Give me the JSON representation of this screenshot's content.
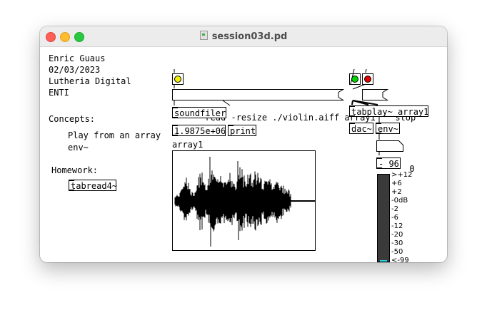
{
  "window": {
    "title": "session03d.pd"
  },
  "header_comments": [
    "Enric Guaus",
    "02/03/2023",
    "Lutheria Digital",
    "ENTI"
  ],
  "concepts": {
    "heading": "Concepts:",
    "items": [
      "Play from an array",
      "env~"
    ]
  },
  "homework": {
    "heading": "Homework:",
    "object": "tabread4~"
  },
  "objects": {
    "read_msg": "read -resize ./violin.aiff array1",
    "soundfiler": "soundfiler",
    "number_out": "1.9875e+06",
    "print": "print",
    "stop_msg": "stop",
    "tabplay": "tabplay~ array1",
    "dac": "dac~",
    "env": "env~",
    "num_env": "0",
    "minus": "- 96"
  },
  "array": {
    "name": "array1"
  },
  "bangs": {
    "left_color": "#f0f000",
    "play_color": "#00d400",
    "stop_color": "#e00000"
  },
  "vu_scale": [
    ">+12",
    "+6",
    "+2",
    "-0dB",
    "-2",
    "-6",
    "-12",
    "-20",
    "-30",
    "-50",
    "<-99"
  ],
  "vu_level_fraction": 0.0
}
